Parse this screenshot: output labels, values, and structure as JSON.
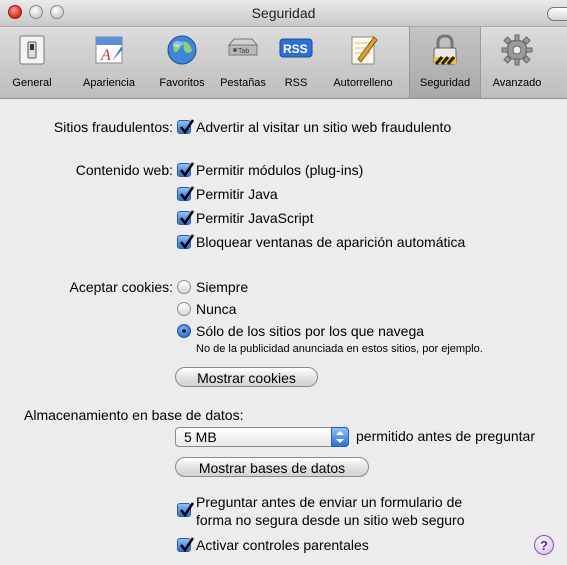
{
  "window": {
    "title": "Seguridad"
  },
  "toolbar": {
    "items": [
      {
        "label": "General",
        "icon": "light-switch-icon"
      },
      {
        "label": "Apariencia",
        "icon": "typography-icon"
      },
      {
        "label": "Favoritos",
        "icon": "globe-icon"
      },
      {
        "label": "Pestañas",
        "icon": "tab-icon"
      },
      {
        "label": "RSS",
        "icon": "rss-icon",
        "icon_text": "RSS"
      },
      {
        "label": "Autorrelleno",
        "icon": "pencil-paper-icon"
      },
      {
        "label": "Seguridad",
        "icon": "padlock-icon",
        "selected": true
      },
      {
        "label": "Avanzado",
        "icon": "gear-icon"
      }
    ],
    "tab_icon_text": "Tab"
  },
  "fraud": {
    "label": "Sitios fraudulentos:",
    "option": "Advertir al visitar un sitio web fraudulento",
    "checked": true
  },
  "web_content": {
    "label": "Contenido web:",
    "options": [
      {
        "label": "Permitir módulos (plug-ins)",
        "checked": true
      },
      {
        "label": "Permitir Java",
        "checked": true
      },
      {
        "label": "Permitir JavaScript",
        "checked": true
      },
      {
        "label": "Bloquear ventanas de aparición automática",
        "checked": true
      }
    ]
  },
  "cookies": {
    "label": "Aceptar cookies:",
    "options": [
      {
        "label": "Siempre",
        "selected": false
      },
      {
        "label": "Nunca",
        "selected": false
      },
      {
        "label": "Sólo de los sitios por los que navega",
        "selected": true
      }
    ],
    "note": "No de la publicidad anunciada en estos sitios, por ejemplo.",
    "show_button": "Mostrar cookies"
  },
  "database": {
    "label": "Almacenamiento en base de datos:",
    "size_value": "5 MB",
    "suffix": "permitido antes de preguntar",
    "show_button": "Mostrar bases de datos"
  },
  "bottom": {
    "ask_form_line1": "Preguntar antes de enviar un formulario de",
    "ask_form_line2": "forma no segura desde un sitio web seguro",
    "ask_form_checked": true,
    "parental_label": "Activar controles parentales",
    "parental_checked": true
  },
  "help": {
    "glyph": "?"
  },
  "colors": {
    "accent": "#2f6fd3",
    "background": "#ececec"
  }
}
